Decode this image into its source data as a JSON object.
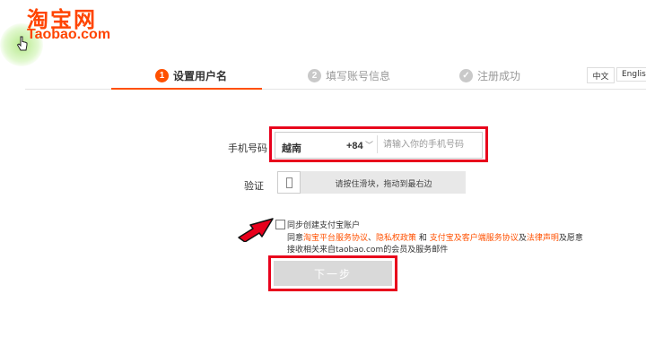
{
  "logo": {
    "cn": "淘宝网",
    "en": "Taobao.com"
  },
  "steps": [
    {
      "num": "1",
      "label": "设置用户名"
    },
    {
      "num": "2",
      "label": "填写账号信息"
    },
    {
      "num": "",
      "label": "注册成功"
    }
  ],
  "language": {
    "cn": "中文",
    "en": "English"
  },
  "phone": {
    "label": "手机号码",
    "country": "越南",
    "code": "+84",
    "placeholder": "请输入你的手机号码"
  },
  "verify": {
    "label": "验证",
    "slider_text": "请按住滑块，拖动到最右边"
  },
  "agreement": {
    "alipay_label": "同步创建支付宝账户",
    "prefix": "同意",
    "link1": "淘宝平台服务协议",
    "sep1": "、",
    "link2": "隐私权政策",
    "and": " 和 ",
    "link3": "支付宝及客户端服务协议",
    "sep2": "及",
    "link4": "法律声明",
    "suffix": "及愿意",
    "line2": "接收相关来自taobao.com的会员及服务邮件"
  },
  "next_label": "下一步",
  "colors": {
    "brand": "#ff5000",
    "highlight": "#e8001c"
  }
}
